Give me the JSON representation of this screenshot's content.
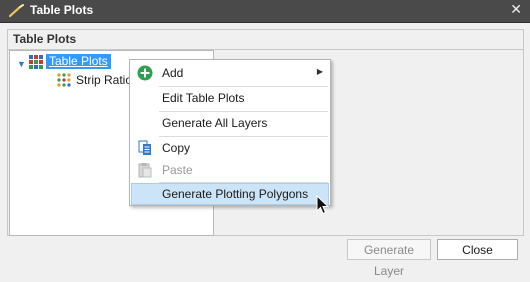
{
  "window": {
    "title": "Table Plots",
    "close_glyph": "✕",
    "app_icon": "wand-icon"
  },
  "group": {
    "header": "Table Plots"
  },
  "tree": {
    "root": {
      "label": "Table Plots",
      "icon": "table-grid-icon",
      "selected": true,
      "expanded": true
    },
    "children": [
      {
        "label": "Strip Ratio",
        "icon": "dot-grid-icon"
      }
    ]
  },
  "context_menu": {
    "items": [
      {
        "label": "Add",
        "icon": "add-plus-icon",
        "submenu": true,
        "enabled": true
      },
      {
        "label": "Edit Table Plots",
        "enabled": true
      },
      {
        "label": "Generate All Layers",
        "enabled": true
      },
      {
        "label": "Copy",
        "icon": "copy-icon",
        "enabled": true
      },
      {
        "label": "Paste",
        "icon": "paste-icon",
        "enabled": false
      },
      {
        "label": "Generate Plotting Polygons",
        "enabled": true,
        "highlighted": true
      }
    ]
  },
  "buttons": {
    "generate_layer": {
      "label": "Generate Layer",
      "enabled": false
    },
    "close": {
      "label": "Close",
      "enabled": true
    }
  },
  "colors": {
    "titlebar": "#4a4a4a",
    "selection": "#3399ff",
    "menu_highlight": "#cce4f7",
    "add_icon_green": "#2e9e4f",
    "copy_icon_blue": "#2f7cc4"
  }
}
